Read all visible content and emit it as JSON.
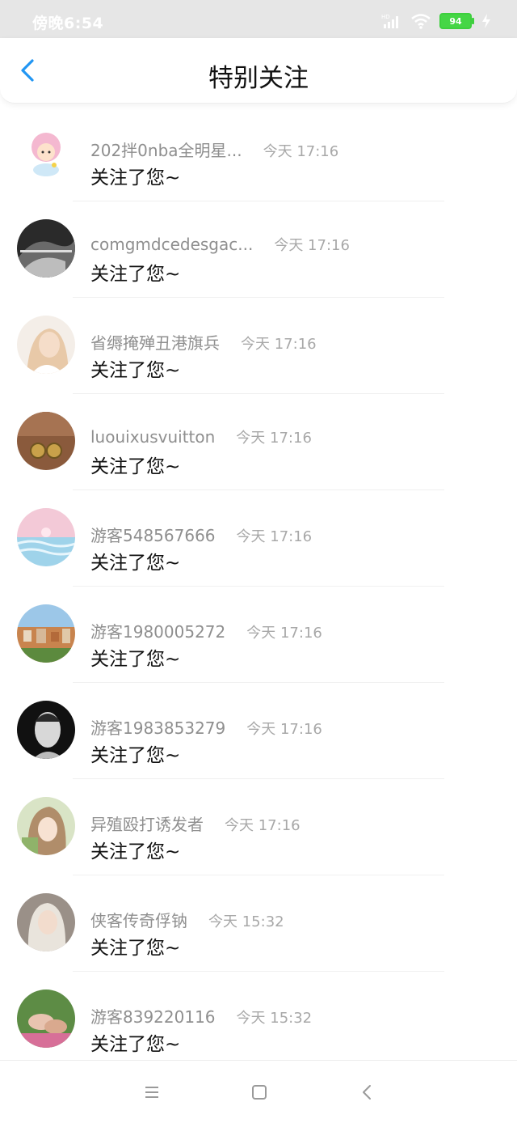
{
  "status_bar": {
    "time": "傍晚6:54",
    "battery": "94"
  },
  "header": {
    "title": "特别关注"
  },
  "items": [
    {
      "username": "202拌0nba全明星...",
      "time": "今天 17:16",
      "message": "关注了您~"
    },
    {
      "username": "comgmdcedesgac...",
      "time": "今天 17:16",
      "message": "关注了您~"
    },
    {
      "username": "省缛掩殚丑港旗兵",
      "time": "今天 17:16",
      "message": "关注了您~"
    },
    {
      "username": "luouixusvuitton",
      "time": "今天 17:16",
      "message": "关注了您~"
    },
    {
      "username": "游客548567666",
      "time": "今天 17:16",
      "message": "关注了您~"
    },
    {
      "username": "游客1980005272",
      "time": "今天 17:16",
      "message": "关注了您~"
    },
    {
      "username": "游客1983853279",
      "time": "今天 17:16",
      "message": "关注了您~"
    },
    {
      "username": "异殖殴打诱发者",
      "time": "今天 17:16",
      "message": "关注了您~"
    },
    {
      "username": "侠客传奇俘钠",
      "time": "今天 15:32",
      "message": "关注了您~"
    },
    {
      "username": "游客839220116",
      "time": "今天 15:32",
      "message": "关注了您~"
    }
  ],
  "colors": {
    "accent": "#2196f3",
    "username": "#8f8f8f",
    "time": "#a8a8a8"
  }
}
